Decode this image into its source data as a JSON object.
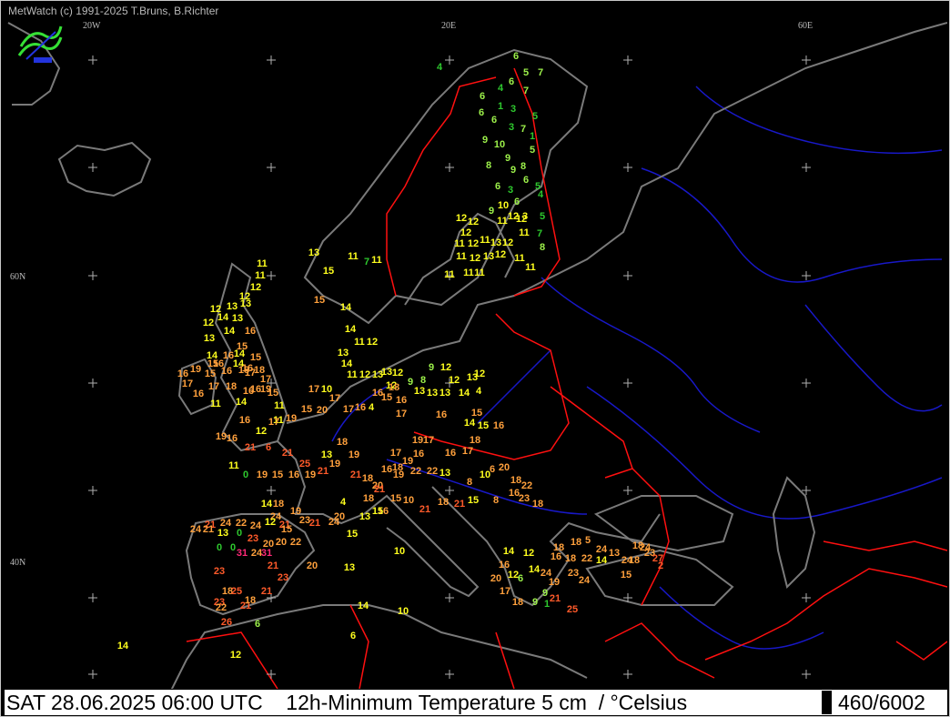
{
  "credit": "MetWatch  (c) 1991-2025 T.Bruns, B.Richter",
  "lon_labels": [
    "20W",
    "20E",
    "60E"
  ],
  "lat_labels": [
    "60N",
    "40N"
  ],
  "status": {
    "left_text": "SAT 28.06.2025 06:00 UTC    12h-Minimum Temperature 5 cm  / °Celsius",
    "right_text": "460/6002"
  },
  "colors": {
    "background": "#000000",
    "coast": "#7a7a7a",
    "border": "#ff1010",
    "river": "#1818c8",
    "grid_cross": "#b0b0b0",
    "green": "#2ec82e",
    "light_green": "#9cf04a",
    "yellow": "#ffff1e",
    "orange": "#ffa03c",
    "red_orange": "#ff5a2a",
    "magenta": "#ff2a78"
  },
  "observations": [
    {
      "t": "4",
      "c": "green"
    },
    {
      "t": "6",
      "c": "light_green"
    },
    {
      "t": "5",
      "c": "light_green"
    },
    {
      "t": "7",
      "c": "light_green"
    },
    {
      "t": "6",
      "c": "light_green"
    },
    {
      "t": "7",
      "c": "light_green"
    },
    {
      "t": "6",
      "c": "light_green"
    },
    {
      "t": "4",
      "c": "green"
    },
    {
      "t": "1",
      "c": "green"
    },
    {
      "t": "3",
      "c": "green"
    },
    {
      "t": "6",
      "c": "light_green"
    },
    {
      "t": "5",
      "c": "green"
    },
    {
      "t": "6",
      "c": "light_green"
    },
    {
      "t": "3",
      "c": "green"
    },
    {
      "t": "7",
      "c": "light_green"
    },
    {
      "t": "9",
      "c": "light_green"
    },
    {
      "t": "10",
      "c": "light_green"
    },
    {
      "t": "1",
      "c": "green"
    },
    {
      "t": "5",
      "c": "light_green"
    },
    {
      "t": "9",
      "c": "light_green"
    },
    {
      "t": "8",
      "c": "light_green"
    },
    {
      "t": "9",
      "c": "light_green"
    },
    {
      "t": "8",
      "c": "light_green"
    },
    {
      "t": "6",
      "c": "light_green"
    },
    {
      "t": "6",
      "c": "light_green"
    },
    {
      "t": "3",
      "c": "green"
    },
    {
      "t": "5",
      "c": "green"
    },
    {
      "t": "4",
      "c": "green"
    },
    {
      "t": "9",
      "c": "light_green"
    },
    {
      "t": "10",
      "c": "yellow"
    },
    {
      "t": "6",
      "c": "light_green"
    },
    {
      "t": "3",
      "c": "yellow"
    },
    {
      "t": "12",
      "c": "yellow"
    },
    {
      "t": "12",
      "c": "yellow"
    },
    {
      "t": "11",
      "c": "yellow"
    },
    {
      "t": "12",
      "c": "yellow"
    },
    {
      "t": "12",
      "c": "yellow"
    },
    {
      "t": "11",
      "c": "yellow"
    },
    {
      "t": "7",
      "c": "green"
    },
    {
      "t": "12",
      "c": "yellow"
    },
    {
      "t": "5",
      "c": "green"
    },
    {
      "t": "11",
      "c": "yellow"
    },
    {
      "t": "12",
      "c": "yellow"
    },
    {
      "t": "11",
      "c": "yellow"
    },
    {
      "t": "13",
      "c": "yellow"
    },
    {
      "t": "12",
      "c": "yellow"
    },
    {
      "t": "12",
      "c": "yellow"
    },
    {
      "t": "11",
      "c": "yellow"
    },
    {
      "t": "12",
      "c": "yellow"
    },
    {
      "t": "13",
      "c": "yellow"
    },
    {
      "t": "11",
      "c": "yellow"
    },
    {
      "t": "11",
      "c": "yellow"
    },
    {
      "t": "11",
      "c": "yellow"
    },
    {
      "t": "11",
      "c": "yellow"
    },
    {
      "t": "8",
      "c": "light_green"
    },
    {
      "t": "11",
      "c": "yellow"
    },
    {
      "t": "11",
      "c": "yellow"
    },
    {
      "t": "13",
      "c": "yellow"
    },
    {
      "t": "11",
      "c": "yellow"
    },
    {
      "t": "15",
      "c": "yellow"
    },
    {
      "t": "7",
      "c": "green"
    },
    {
      "t": "15",
      "c": "orange"
    },
    {
      "t": "14",
      "c": "yellow"
    },
    {
      "t": "11",
      "c": "yellow"
    },
    {
      "t": "11",
      "c": "yellow"
    },
    {
      "t": "12",
      "c": "yellow"
    },
    {
      "t": "12",
      "c": "yellow"
    },
    {
      "t": "12",
      "c": "yellow"
    },
    {
      "t": "13",
      "c": "yellow"
    },
    {
      "t": "13",
      "c": "yellow"
    },
    {
      "t": "12",
      "c": "yellow"
    },
    {
      "t": "14",
      "c": "yellow"
    },
    {
      "t": "13",
      "c": "yellow"
    },
    {
      "t": "14",
      "c": "yellow"
    },
    {
      "t": "16",
      "c": "orange"
    },
    {
      "t": "13",
      "c": "yellow"
    },
    {
      "t": "15",
      "c": "orange"
    },
    {
      "t": "14",
      "c": "yellow"
    },
    {
      "t": "16",
      "c": "orange"
    },
    {
      "t": "14",
      "c": "yellow"
    },
    {
      "t": "15",
      "c": "orange"
    },
    {
      "t": "16",
      "c": "orange"
    },
    {
      "t": "14",
      "c": "yellow"
    },
    {
      "t": "16",
      "c": "orange"
    },
    {
      "t": "15",
      "c": "orange"
    },
    {
      "t": "18",
      "c": "orange"
    },
    {
      "t": "17",
      "c": "orange"
    },
    {
      "t": "16",
      "c": "orange"
    },
    {
      "t": "19",
      "c": "orange"
    },
    {
      "t": "15",
      "c": "orange"
    },
    {
      "t": "16",
      "c": "orange"
    },
    {
      "t": "18",
      "c": "orange"
    },
    {
      "t": "17",
      "c": "orange"
    },
    {
      "t": "16",
      "c": "orange"
    },
    {
      "t": "19",
      "c": "orange"
    },
    {
      "t": "15",
      "c": "orange"
    },
    {
      "t": "17",
      "c": "orange"
    },
    {
      "t": "16",
      "c": "orange"
    },
    {
      "t": "17",
      "c": "orange"
    },
    {
      "t": "18",
      "c": "orange"
    },
    {
      "t": "16",
      "c": "orange"
    },
    {
      "t": "14",
      "c": "yellow"
    },
    {
      "t": "11",
      "c": "yellow"
    },
    {
      "t": "11",
      "c": "yellow"
    },
    {
      "t": "11",
      "c": "yellow"
    },
    {
      "t": "13",
      "c": "yellow"
    },
    {
      "t": "14",
      "c": "yellow"
    },
    {
      "t": "11",
      "c": "yellow"
    },
    {
      "t": "11",
      "c": "yellow"
    },
    {
      "t": "14",
      "c": "yellow"
    },
    {
      "t": "12",
      "c": "yellow"
    },
    {
      "t": "12",
      "c": "yellow"
    },
    {
      "t": "13",
      "c": "yellow"
    },
    {
      "t": "13",
      "c": "yellow"
    },
    {
      "t": "12",
      "c": "yellow"
    },
    {
      "t": "12",
      "c": "yellow"
    },
    {
      "t": "9",
      "c": "light_green"
    },
    {
      "t": "8",
      "c": "light_green"
    },
    {
      "t": "9",
      "c": "light_green"
    },
    {
      "t": "12",
      "c": "yellow"
    },
    {
      "t": "12",
      "c": "yellow"
    },
    {
      "t": "13",
      "c": "yellow"
    },
    {
      "t": "12",
      "c": "yellow"
    },
    {
      "t": "13",
      "c": "yellow"
    },
    {
      "t": "13",
      "c": "yellow"
    },
    {
      "t": "13",
      "c": "yellow"
    },
    {
      "t": "14",
      "c": "yellow"
    },
    {
      "t": "4",
      "c": "yellow"
    },
    {
      "t": "4",
      "c": "yellow"
    },
    {
      "t": "16",
      "c": "orange"
    },
    {
      "t": "15",
      "c": "orange"
    },
    {
      "t": "18",
      "c": "orange"
    },
    {
      "t": "16",
      "c": "orange"
    },
    {
      "t": "17",
      "c": "orange"
    },
    {
      "t": "16",
      "c": "orange"
    },
    {
      "t": "15",
      "c": "orange"
    },
    {
      "t": "14",
      "c": "yellow"
    },
    {
      "t": "15",
      "c": "yellow"
    },
    {
      "t": "16",
      "c": "orange"
    },
    {
      "t": "18",
      "c": "orange"
    },
    {
      "t": "17",
      "c": "orange"
    },
    {
      "t": "19",
      "c": "orange"
    },
    {
      "t": "17",
      "c": "orange"
    },
    {
      "t": "16",
      "c": "orange"
    },
    {
      "t": "17",
      "c": "orange"
    },
    {
      "t": "16",
      "c": "orange"
    },
    {
      "t": "19",
      "c": "orange"
    },
    {
      "t": "18",
      "c": "orange"
    },
    {
      "t": "19",
      "c": "orange"
    },
    {
      "t": "18",
      "c": "orange"
    },
    {
      "t": "17",
      "c": "orange"
    },
    {
      "t": "10",
      "c": "yellow"
    },
    {
      "t": "17",
      "c": "orange"
    },
    {
      "t": "20",
      "c": "orange"
    },
    {
      "t": "15",
      "c": "orange"
    },
    {
      "t": "19",
      "c": "orange"
    },
    {
      "t": "17",
      "c": "orange"
    },
    {
      "t": "12",
      "c": "yellow"
    },
    {
      "t": "16",
      "c": "orange"
    },
    {
      "t": "16",
      "c": "orange"
    },
    {
      "t": "19",
      "c": "orange"
    },
    {
      "t": "11",
      "c": "yellow"
    },
    {
      "t": "21",
      "c": "red_orange"
    },
    {
      "t": "6",
      "c": "red_orange"
    },
    {
      "t": "21",
      "c": "red_orange"
    },
    {
      "t": "25",
      "c": "red_orange"
    },
    {
      "t": "21",
      "c": "red_orange"
    },
    {
      "t": "0",
      "c": "green"
    },
    {
      "t": "19",
      "c": "orange"
    },
    {
      "t": "15",
      "c": "orange"
    },
    {
      "t": "16",
      "c": "orange"
    },
    {
      "t": "19",
      "c": "orange"
    },
    {
      "t": "17",
      "c": "orange"
    },
    {
      "t": "16",
      "c": "orange"
    },
    {
      "t": "13",
      "c": "yellow"
    },
    {
      "t": "19",
      "c": "orange"
    },
    {
      "t": "21",
      "c": "red_orange"
    },
    {
      "t": "18",
      "c": "orange"
    },
    {
      "t": "20",
      "c": "orange"
    },
    {
      "t": "16",
      "c": "orange"
    },
    {
      "t": "19",
      "c": "orange"
    },
    {
      "t": "22",
      "c": "orange"
    },
    {
      "t": "22",
      "c": "orange"
    },
    {
      "t": "13",
      "c": "yellow"
    },
    {
      "t": "8",
      "c": "orange"
    },
    {
      "t": "10",
      "c": "yellow"
    },
    {
      "t": "6",
      "c": "orange"
    },
    {
      "t": "20",
      "c": "orange"
    },
    {
      "t": "18",
      "c": "orange"
    },
    {
      "t": "22",
      "c": "orange"
    },
    {
      "t": "18",
      "c": "orange"
    },
    {
      "t": "23",
      "c": "orange"
    },
    {
      "t": "16",
      "c": "orange"
    },
    {
      "t": "8",
      "c": "orange"
    },
    {
      "t": "15",
      "c": "yellow"
    },
    {
      "t": "21",
      "c": "red_orange"
    },
    {
      "t": "18",
      "c": "orange"
    },
    {
      "t": "21",
      "c": "red_orange"
    },
    {
      "t": "10",
      "c": "orange"
    },
    {
      "t": "15",
      "c": "orange"
    },
    {
      "t": "21",
      "c": "red_orange"
    },
    {
      "t": "18",
      "c": "orange"
    },
    {
      "t": "16",
      "c": "orange"
    },
    {
      "t": "4",
      "c": "yellow"
    },
    {
      "t": "24",
      "c": "orange"
    },
    {
      "t": "20",
      "c": "orange"
    },
    {
      "t": "13",
      "c": "yellow"
    },
    {
      "t": "15",
      "c": "yellow"
    },
    {
      "t": "18",
      "c": "orange"
    },
    {
      "t": "14",
      "c": "yellow"
    },
    {
      "t": "24",
      "c": "orange"
    },
    {
      "t": "21",
      "c": "red_orange"
    },
    {
      "t": "12",
      "c": "yellow"
    },
    {
      "t": "15",
      "c": "orange"
    },
    {
      "t": "19",
      "c": "orange"
    },
    {
      "t": "23",
      "c": "orange"
    },
    {
      "t": "21",
      "c": "red_orange"
    },
    {
      "t": "22",
      "c": "orange"
    },
    {
      "t": "20",
      "c": "orange"
    },
    {
      "t": "24",
      "c": "orange"
    },
    {
      "t": "21",
      "c": "red_orange"
    },
    {
      "t": "22",
      "c": "orange"
    },
    {
      "t": "24",
      "c": "orange"
    },
    {
      "t": "24",
      "c": "orange"
    },
    {
      "t": "21",
      "c": "orange"
    },
    {
      "t": "13",
      "c": "yellow"
    },
    {
      "t": "0",
      "c": "green"
    },
    {
      "t": "23",
      "c": "red_orange"
    },
    {
      "t": "20",
      "c": "orange"
    },
    {
      "t": "0",
      "c": "green"
    },
    {
      "t": "0",
      "c": "green"
    },
    {
      "t": "24",
      "c": "orange"
    },
    {
      "t": "31",
      "c": "magenta"
    },
    {
      "t": "31",
      "c": "magenta"
    },
    {
      "t": "21",
      "c": "red_orange"
    },
    {
      "t": "23",
      "c": "red_orange"
    },
    {
      "t": "18",
      "c": "orange"
    },
    {
      "t": "23",
      "c": "red_orange"
    },
    {
      "t": "20",
      "c": "orange"
    },
    {
      "t": "23",
      "c": "red_orange"
    },
    {
      "t": "25",
      "c": "red_orange"
    },
    {
      "t": "21",
      "c": "red_orange"
    },
    {
      "t": "18",
      "c": "orange"
    },
    {
      "t": "21",
      "c": "red_orange"
    },
    {
      "t": "22",
      "c": "orange"
    },
    {
      "t": "26",
      "c": "red_orange"
    },
    {
      "t": "6",
      "c": "light_green"
    },
    {
      "t": "14",
      "c": "yellow"
    },
    {
      "t": "12",
      "c": "yellow"
    },
    {
      "t": "15",
      "c": "yellow"
    },
    {
      "t": "13",
      "c": "yellow"
    },
    {
      "t": "10",
      "c": "yellow"
    },
    {
      "t": "14",
      "c": "yellow"
    },
    {
      "t": "10",
      "c": "yellow"
    },
    {
      "t": "6",
      "c": "yellow"
    },
    {
      "t": "14",
      "c": "yellow"
    },
    {
      "t": "12",
      "c": "yellow"
    },
    {
      "t": "14",
      "c": "yellow"
    },
    {
      "t": "16",
      "c": "orange"
    },
    {
      "t": "12",
      "c": "yellow"
    },
    {
      "t": "20",
      "c": "orange"
    },
    {
      "t": "6",
      "c": "light_green"
    },
    {
      "t": "17",
      "c": "orange"
    },
    {
      "t": "18",
      "c": "orange"
    },
    {
      "t": "9",
      "c": "light_green"
    },
    {
      "t": "9",
      "c": "light_green"
    },
    {
      "t": "1",
      "c": "green"
    },
    {
      "t": "16",
      "c": "orange"
    },
    {
      "t": "18",
      "c": "orange"
    },
    {
      "t": "18",
      "c": "orange"
    },
    {
      "t": "5",
      "c": "orange"
    },
    {
      "t": "22",
      "c": "orange"
    },
    {
      "t": "18",
      "c": "orange"
    },
    {
      "t": "24",
      "c": "orange"
    },
    {
      "t": "19",
      "c": "orange"
    },
    {
      "t": "21",
      "c": "red_orange"
    },
    {
      "t": "25",
      "c": "red_orange"
    },
    {
      "t": "23",
      "c": "orange"
    },
    {
      "t": "24",
      "c": "orange"
    },
    {
      "t": "14",
      "c": "yellow"
    },
    {
      "t": "24",
      "c": "orange"
    },
    {
      "t": "13",
      "c": "orange"
    },
    {
      "t": "18",
      "c": "orange"
    },
    {
      "t": "24",
      "c": "orange"
    },
    {
      "t": "18",
      "c": "orange"
    },
    {
      "t": "23",
      "c": "orange"
    },
    {
      "t": "24",
      "c": "orange"
    },
    {
      "t": "27",
      "c": "red_orange"
    },
    {
      "t": "2",
      "c": "red_orange"
    },
    {
      "t": "15",
      "c": "orange"
    }
  ]
}
